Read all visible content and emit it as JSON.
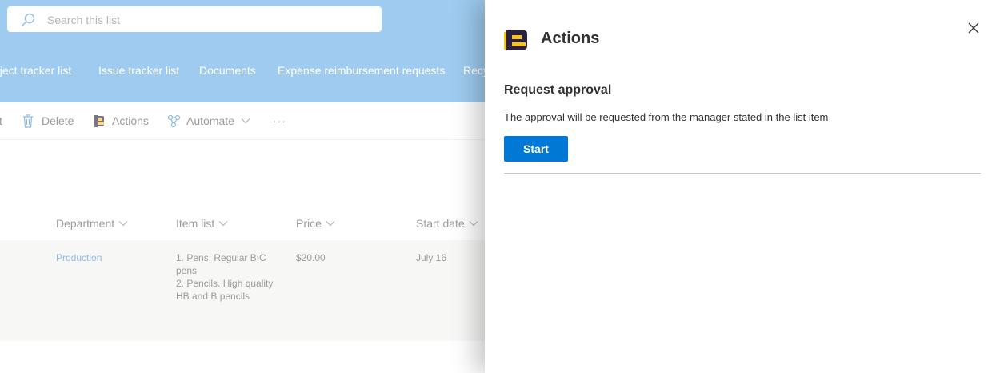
{
  "search": {
    "placeholder": "Search this list"
  },
  "nav": {
    "links": [
      "oject tracker list",
      "Issue tracker list",
      "Documents",
      "Expense reimbursement requests",
      "Recy"
    ]
  },
  "commands": {
    "edit_fragment": "t",
    "delete": "Delete",
    "actions": "Actions",
    "automate": "Automate",
    "more": "···"
  },
  "columns": [
    "Department",
    "Item list",
    "Price",
    "Start date"
  ],
  "row": {
    "department": "Production",
    "items": [
      "1. Pens. Regular BIC pens",
      "2. Pencils. High quality HB and B pencils"
    ],
    "price": "$20.00",
    "start_date": "July 16"
  },
  "panel": {
    "title": "Actions",
    "section_title": "Request approval",
    "description": "The approval will be requested from the manager stated in the list item",
    "start_button": "Start",
    "colors": {
      "accent": "#0078d4",
      "logo_dark": "#2b2041",
      "logo_yellow": "#f5c518"
    }
  },
  "colors": {
    "header_band": "#63abe5",
    "row_bg": "#f3f2f1",
    "link": "#4b8fd6"
  }
}
